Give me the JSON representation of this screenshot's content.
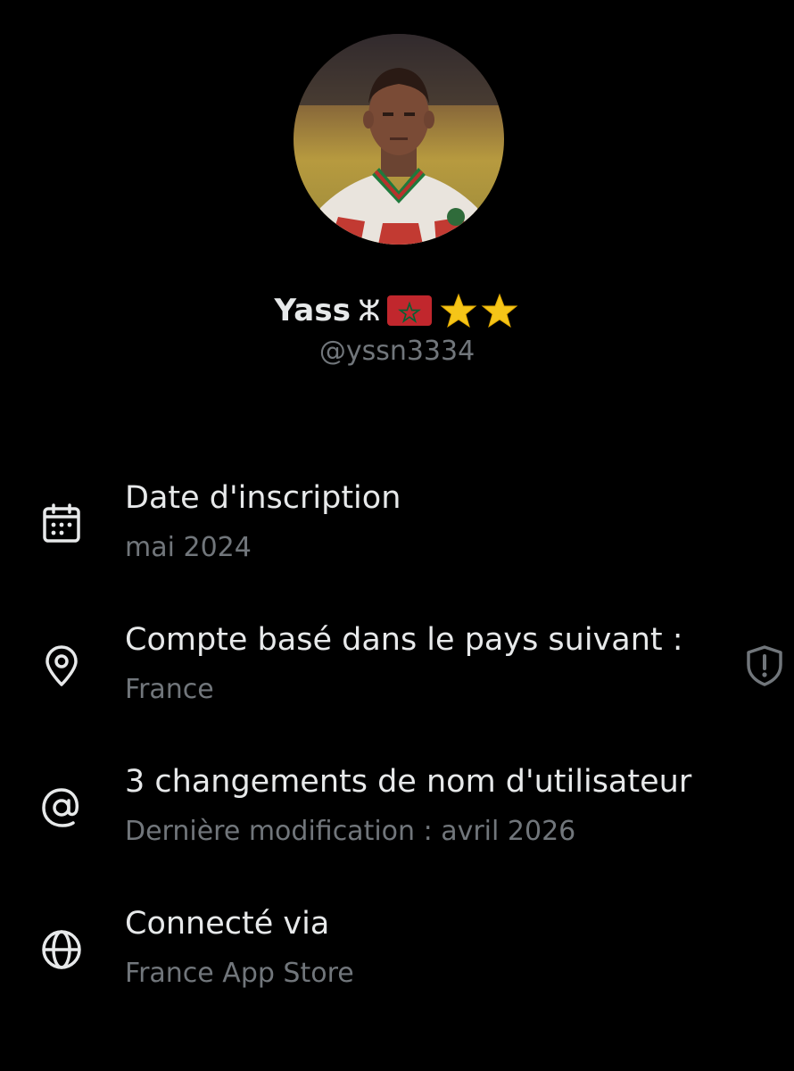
{
  "profile": {
    "display_name": "Yass",
    "name_glyph": "ⵣ",
    "flag": "morocco-flag",
    "stars": [
      "star-icon",
      "star-icon"
    ],
    "handle": "@yssn3334",
    "avatar": "profile-photo"
  },
  "info": [
    {
      "icon": "calendar-icon",
      "title": "Date d'inscription",
      "subtitle": "mai 2024"
    },
    {
      "icon": "location-pin-icon",
      "title": "Compte basé dans le pays suivant :",
      "subtitle": "France",
      "trailing_icon": "shield-alert-icon"
    },
    {
      "icon": "at-sign-icon",
      "title": "3 changements de nom d'utilisateur",
      "subtitle": "Dernière modification : avril 2026"
    },
    {
      "icon": "globe-icon",
      "title": "Connecté via",
      "subtitle": "France App Store"
    }
  ],
  "colors": {
    "background": "#000000",
    "primary_text": "#e7e9ea",
    "secondary_text": "#71767b",
    "star": "#f5c518",
    "flag_red": "#c1272d",
    "flag_green": "#006233"
  }
}
